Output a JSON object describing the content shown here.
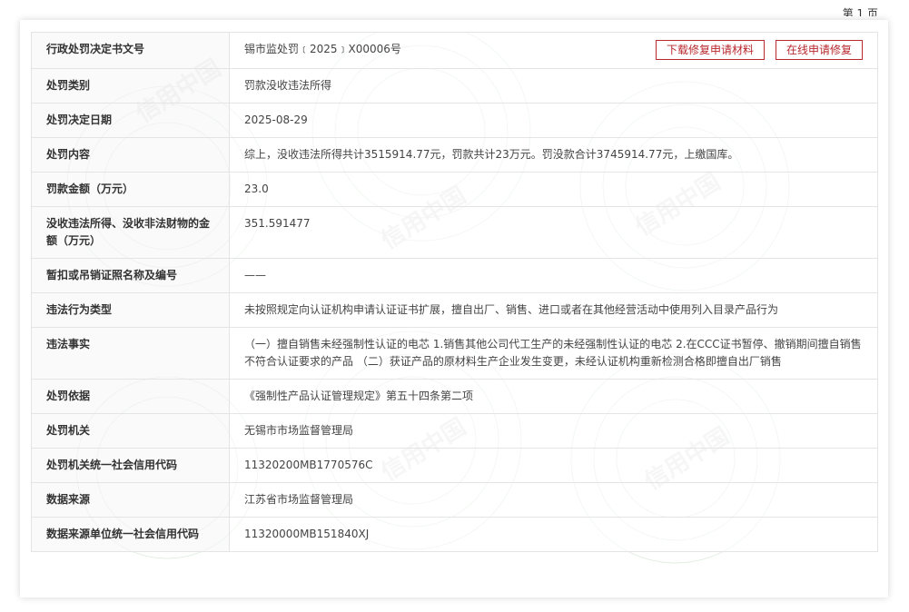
{
  "page_number": "第 1 页",
  "watermark_text": "信用中国",
  "accent_color": "#b8282d",
  "actions": {
    "download_label": "下载修复申请材料",
    "online_label": "在线申请修复"
  },
  "rows": [
    {
      "label": "行政处罚决定书文号",
      "value": "锡市监处罚﹝2025﹞X00006号"
    },
    {
      "label": "处罚类别",
      "value": "罚款没收违法所得"
    },
    {
      "label": "处罚决定日期",
      "value": "2025-08-29"
    },
    {
      "label": "处罚内容",
      "value": "综上，没收违法所得共计3515914.77元，罚款共计23万元。罚没款合计3745914.77元，上缴国库。"
    },
    {
      "label": "罚款金额（万元）",
      "value": "23.0"
    },
    {
      "label": "没收违法所得、没收非法财物的金额（万元）",
      "value": "351.591477"
    },
    {
      "label": "暂扣或吊销证照名称及编号",
      "value": "——"
    },
    {
      "label": "违法行为类型",
      "value": "未按照规定向认证机构申请认证证书扩展，擅自出厂、销售、进口或者在其他经营活动中使用列入目录产品行为"
    },
    {
      "label": "违法事实",
      "value": "（一）擅自销售未经强制性认证的电芯 1.销售其他公司代工生产的未经强制性认证的电芯 2.在CCC证书暂停、撤销期间擅自销售不符合认证要求的产品 （二）获证产品的原材料生产企业发生变更，未经认证机构重新检测合格即擅自出厂销售"
    },
    {
      "label": "处罚依据",
      "value": "《强制性产品认证管理规定》第五十四条第二项"
    },
    {
      "label": "处罚机关",
      "value": "无锡市市场监督管理局"
    },
    {
      "label": "处罚机关统一社会信用代码",
      "value": "11320200MB1770576C"
    },
    {
      "label": "数据来源",
      "value": "江苏省市场监督管理局"
    },
    {
      "label": "数据来源单位统一社会信用代码",
      "value": "11320000MB151840XJ"
    }
  ]
}
